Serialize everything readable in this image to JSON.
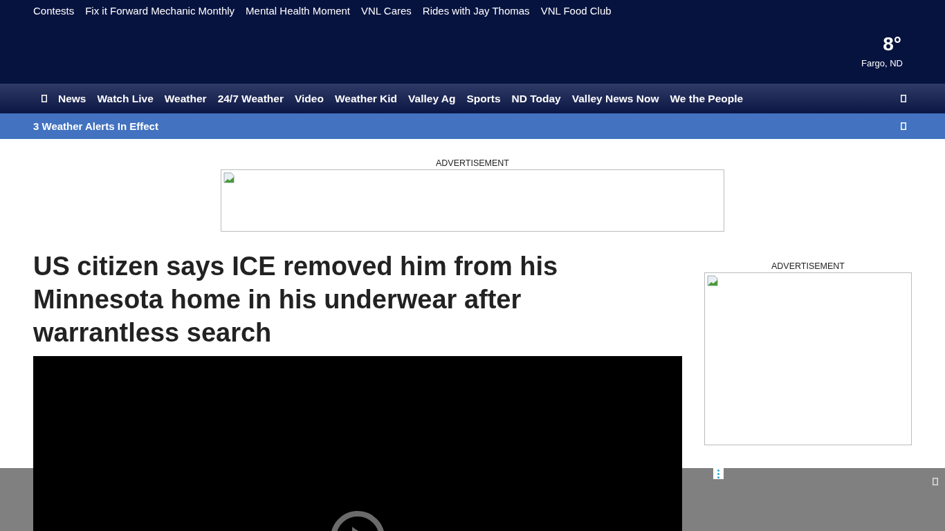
{
  "top_links": [
    "Contests",
    "Fix it Forward Mechanic Monthly",
    "Mental Health Moment",
    "VNL Cares",
    "Rides with Jay Thomas",
    "VNL Food Club"
  ],
  "weather": {
    "temperature": "8°",
    "location": "Fargo, ND"
  },
  "nav": [
    "News",
    "Watch Live",
    "Weather",
    "24/7 Weather",
    "Video",
    "Weather Kid",
    "Valley Ag",
    "Sports",
    "ND Today",
    "Valley News Now",
    "We the People"
  ],
  "alert_bar": {
    "text": "3 Weather Alerts In Effect"
  },
  "top_ad": {
    "label": "ADVERTISEMENT"
  },
  "article": {
    "headline": "US citizen says ICE removed him from his Minnesota home in his underwear after warrantless search"
  },
  "side_ad": {
    "label": "ADVERTISEMENT"
  }
}
